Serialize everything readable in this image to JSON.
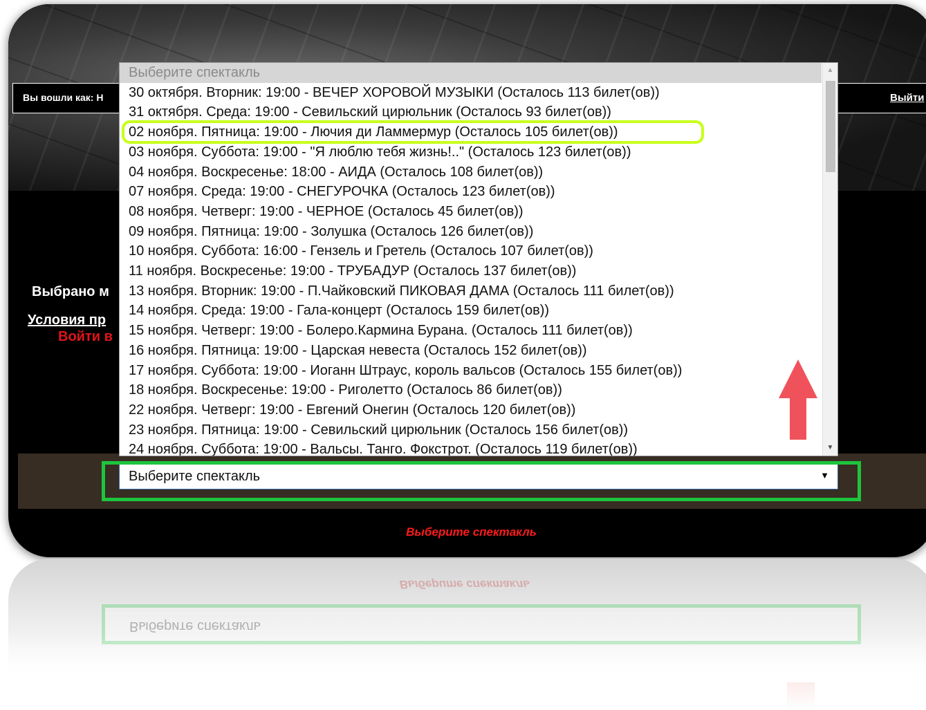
{
  "header": {
    "login_label": "Вы вошли как: Н",
    "logout_label": "Выйти"
  },
  "sidebar": {
    "selected_text": "Выбрано м",
    "terms_link": "Условия пр",
    "login_red": "Войти в"
  },
  "select": {
    "current_value": "Выберите спектакль",
    "arrow": "▼"
  },
  "dropdown": {
    "placeholder": "Выберите спектакль",
    "scroll_up": "▲",
    "scroll_down": "▼",
    "highlighted_index": 3,
    "options": [
      "30 октября. Вторник: 19:00 - ВЕЧЕР ХОРОВОЙ МУЗЫКИ (Осталось 113 билет(ов))",
      "31 октября. Среда: 19:00 - Севильский цирюльник (Осталось 93 билет(ов))",
      "02 ноября. Пятница: 19:00 - Лючия ди Ламмермур (Осталось 105 билет(ов))",
      "03 ноября. Суббота: 19:00 - \"Я люблю тебя жизнь!..\" (Осталось 123 билет(ов))",
      "04 ноября. Воскресенье: 18:00 - АИДА (Осталось 108 билет(ов))",
      "07 ноября. Среда: 19:00 - СНЕГУРОЧКА (Осталось 123 билет(ов))",
      "08 ноября. Четверг: 19:00 - ЧЕРНОЕ (Осталось 45 билет(ов))",
      "09 ноября. Пятница: 19:00 - Золушка (Осталось 126 билет(ов))",
      "10 ноября. Суббота: 16:00 - Гензель и Гретель (Осталось 107 билет(ов))",
      "11 ноября. Воскресенье: 19:00 - ТРУБАДУР (Осталось 137 билет(ов))",
      "13 ноября. Вторник: 19:00 - П.Чайковский ПИКОВАЯ ДАМА (Осталось 111 билет(ов))",
      "14 ноября. Среда: 19:00 - Гала-концерт (Осталось 159 билет(ов))",
      "15 ноября. Четверг: 19:00 - Болеро.Кармина Бурана. (Осталось 111 билет(ов))",
      "16 ноября. Пятница: 19:00 - Царская невеста (Осталось 152 билет(ов))",
      "17 ноября. Суббота: 19:00 - Иоганн Штраус, король вальсов (Осталось 155 билет(ов))",
      "18 ноября. Воскресенье: 19:00 - Риголетто (Осталось 86 билет(ов))",
      "22 ноября. Четверг: 19:00 - Евгений Онегин (Осталось 120 билет(ов))",
      "23 ноября. Пятница: 19:00 - Севильский цирюльник (Осталось 156 билет(ов))",
      "24 ноября. Суббота: 19:00 - Вальсы. Танго. Фокстрот. (Осталось 119 билет(ов))"
    ]
  },
  "footer": {
    "prompt": "Выберите спектакль"
  },
  "colors": {
    "highlight_option_border": "#c7ff1a",
    "select_highlight_border": "#1ec43d",
    "arrow": "#f0525b",
    "prompt_red": "#ff1a1a"
  }
}
